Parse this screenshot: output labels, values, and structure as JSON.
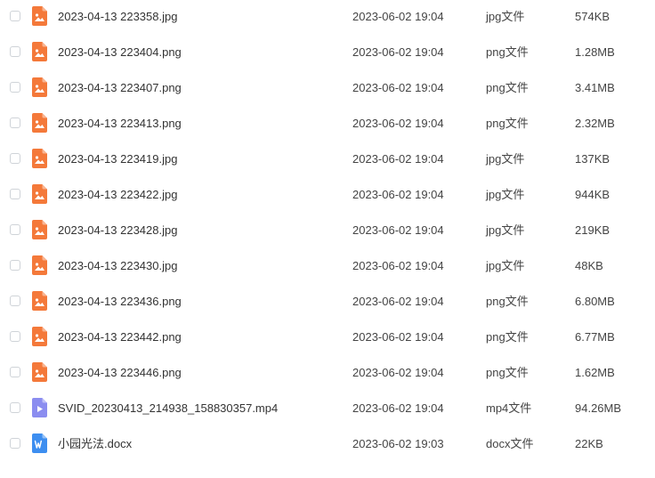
{
  "colors": {
    "image_icon": "#f4793a",
    "video_icon": "#8b8df0",
    "word_icon": "#3d8ef0",
    "checkbox_border": "#cfd3d8"
  },
  "files": [
    {
      "name": "2023-04-13 223358.jpg",
      "modified": "2023-06-02 19:04",
      "type": "jpg文件",
      "size": "574KB",
      "icon": "image-file-icon"
    },
    {
      "name": "2023-04-13 223404.png",
      "modified": "2023-06-02 19:04",
      "type": "png文件",
      "size": "1.28MB",
      "icon": "image-file-icon"
    },
    {
      "name": "2023-04-13 223407.png",
      "modified": "2023-06-02 19:04",
      "type": "png文件",
      "size": "3.41MB",
      "icon": "image-file-icon"
    },
    {
      "name": "2023-04-13 223413.png",
      "modified": "2023-06-02 19:04",
      "type": "png文件",
      "size": "2.32MB",
      "icon": "image-file-icon"
    },
    {
      "name": "2023-04-13 223419.jpg",
      "modified": "2023-06-02 19:04",
      "type": "jpg文件",
      "size": "137KB",
      "icon": "image-file-icon"
    },
    {
      "name": "2023-04-13 223422.jpg",
      "modified": "2023-06-02 19:04",
      "type": "jpg文件",
      "size": "944KB",
      "icon": "image-file-icon"
    },
    {
      "name": "2023-04-13 223428.jpg",
      "modified": "2023-06-02 19:04",
      "type": "jpg文件",
      "size": "219KB",
      "icon": "image-file-icon"
    },
    {
      "name": "2023-04-13 223430.jpg",
      "modified": "2023-06-02 19:04",
      "type": "jpg文件",
      "size": "48KB",
      "icon": "image-file-icon"
    },
    {
      "name": "2023-04-13 223436.png",
      "modified": "2023-06-02 19:04",
      "type": "png文件",
      "size": "6.80MB",
      "icon": "image-file-icon"
    },
    {
      "name": "2023-04-13 223442.png",
      "modified": "2023-06-02 19:04",
      "type": "png文件",
      "size": "6.77MB",
      "icon": "image-file-icon"
    },
    {
      "name": "2023-04-13 223446.png",
      "modified": "2023-06-02 19:04",
      "type": "png文件",
      "size": "1.62MB",
      "icon": "image-file-icon"
    },
    {
      "name": "SVID_20230413_214938_158830357.mp4",
      "modified": "2023-06-02 19:04",
      "type": "mp4文件",
      "size": "94.26MB",
      "icon": "video-file-icon"
    },
    {
      "name": "小园光法.docx",
      "modified": "2023-06-02 19:03",
      "type": "docx文件",
      "size": "22KB",
      "icon": "word-file-icon"
    }
  ]
}
